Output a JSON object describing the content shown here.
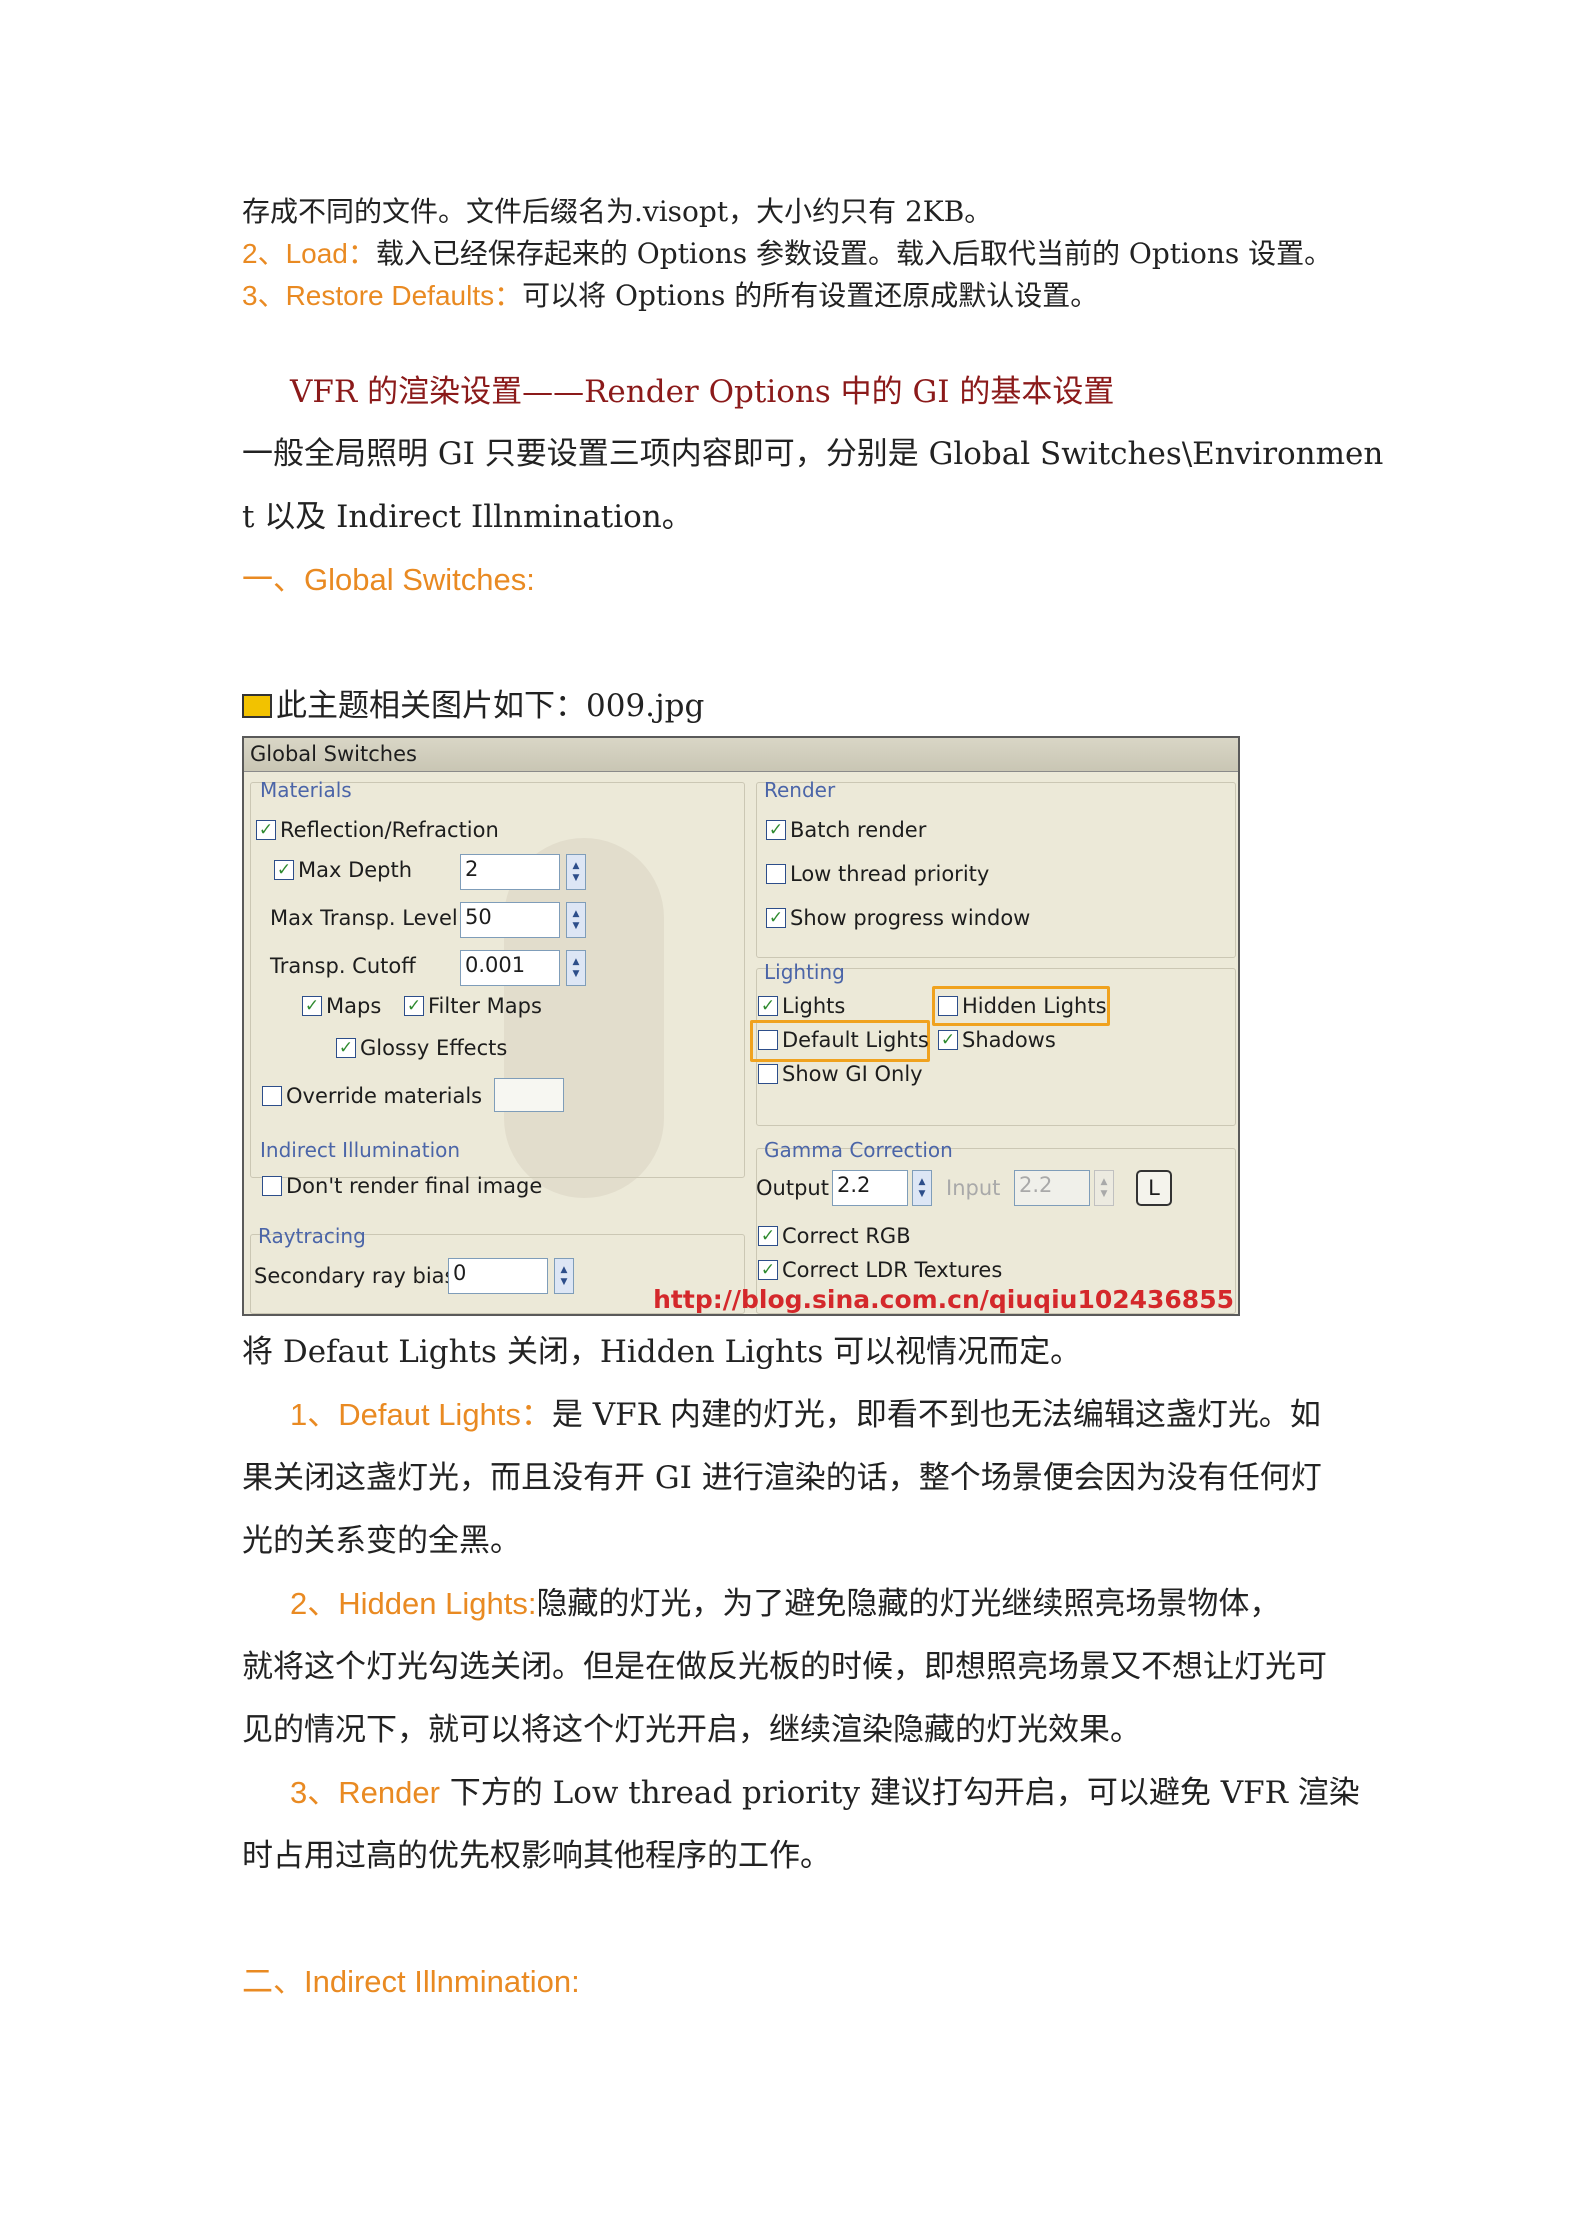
{
  "text": {
    "p1": "存成不同的文件。文件后缀名为.visopt，大小约只有 2KB。",
    "p2_head": "2、Load：",
    "p2_body": "载入已经保存起来的 Options 参数设置。载入后取代当前的 Options 设置。",
    "p3_head": "3、Restore Defaults：",
    "p3_body": "可以将 Options 的所有设置还原成默认设置。",
    "section_title": "VFR 的渲染设置——Render  Options 中的 GI 的基本设置",
    "intro_1": "一般全局照明 GI 只要设置三项内容即可，分别是 Global  Switches\\Environmen",
    "intro_2": "t 以及 Indirect  Illnmination。",
    "heading1": "一、Global  Switches:",
    "img_caption": "此主题相关图片如下：009.jpg",
    "after_img": "将 Defaut  Lights 关闭，Hidden  Lights 可以视情况而定。",
    "item1_head": "1、Defaut  Lights：",
    "item1_l1": "是 VFR 内建的灯光，即看不到也无法编辑这盏灯光。如",
    "item1_l2": "果关闭这盏灯光，而且没有开 GI 进行渲染的话，整个场景便会因为没有任何灯",
    "item1_l3": "光的关系变的全黑。",
    "item2_head": "2、Hidden  Lights:",
    "item2_l1": "隐藏的灯光，为了避免隐藏的灯光继续照亮场景物体，",
    "item2_l2": "就将这个灯光勾选关闭。但是在做反光板的时候，即想照亮场景又不想让灯光可",
    "item2_l3": "见的情况下，就可以将这个灯光开启，继续渲染隐藏的灯光效果。",
    "item3_head": "3、Render",
    "item3_l1": " 下方的 Low  thread  priority 建议打勾开启，可以避免 VFR 渲染",
    "item3_l2": "时占用过高的优先权影响其他程序的工作。",
    "heading2": "二、Indirect  Illnmination:"
  },
  "panel": {
    "title": "Global Switches",
    "materials": {
      "title": "Materials",
      "reflection": "Reflection/Refraction",
      "max_depth": "Max Depth",
      "max_depth_val": "2",
      "max_transp": "Max Transp. Level",
      "max_transp_val": "50",
      "transp_cutoff": "Transp. Cutoff",
      "transp_cutoff_val": "0.001",
      "maps": "Maps",
      "filter_maps": "Filter Maps",
      "glossy": "Glossy Effects",
      "override": "Override materials"
    },
    "render": {
      "title": "Render",
      "batch": "Batch render",
      "low_thread": "Low thread priority",
      "progress": "Show progress window"
    },
    "lighting": {
      "title": "Lighting",
      "lights": "Lights",
      "hidden": "Hidden Lights",
      "default": "Default Lights",
      "shadows": "Shadows",
      "gi_only": "Show GI Only"
    },
    "indirect": {
      "title": "Indirect Illumination",
      "dont_render": "Don't render final image"
    },
    "raytracing": {
      "title": "Raytracing",
      "secondary": "Secondary ray bias",
      "secondary_val": "0"
    },
    "gamma": {
      "title": "Gamma Correction",
      "output": "Output",
      "output_val": "2.2",
      "input": "Input",
      "input_val": "2.2",
      "l_button": "L",
      "correct_rgb": "Correct RGB",
      "correct_ldr": "Correct LDR Textures"
    },
    "watermark": "http://blog.sina.com.cn/qiuqiu102436855",
    "check": "✓"
  },
  "colors": {
    "accent_orange": "#e98a22",
    "title_red": "#8b1a1a",
    "highlight": "#f0a21e"
  }
}
